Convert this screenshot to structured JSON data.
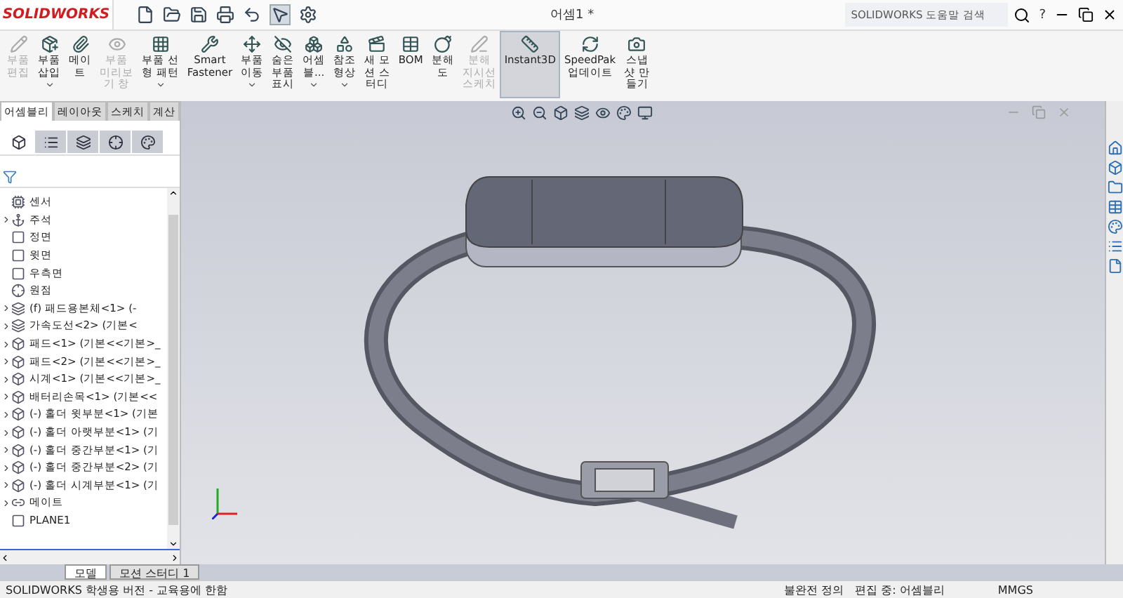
{
  "app": {
    "logo": "SOLIDWORKS",
    "title": "어셈1 *"
  },
  "search": {
    "placeholder": "SOLIDWORKS 도움말 검색"
  },
  "help": "?",
  "ribbon": [
    {
      "lines": [
        "부품",
        "편집"
      ],
      "disabled": true,
      "caret": false,
      "selected": false
    },
    {
      "lines": [
        "부품",
        "삽입"
      ],
      "disabled": false,
      "caret": true,
      "selected": false
    },
    {
      "lines": [
        "메이",
        "트"
      ],
      "disabled": false,
      "caret": false,
      "selected": false
    },
    {
      "lines": [
        "부품",
        "미리보",
        "기 창"
      ],
      "disabled": true,
      "caret": false,
      "selected": false
    },
    {
      "lines": [
        "부품 선",
        "형 패턴"
      ],
      "disabled": false,
      "caret": true,
      "selected": false
    },
    {
      "lines": [
        "Smart",
        "Fastener"
      ],
      "disabled": false,
      "caret": false,
      "selected": false
    },
    {
      "lines": [
        "부품",
        "이동"
      ],
      "disabled": false,
      "caret": true,
      "selected": false
    },
    {
      "lines": [
        "숨은",
        "부품",
        "표시"
      ],
      "disabled": false,
      "caret": false,
      "selected": false
    },
    {
      "lines": [
        "어셈",
        "블..."
      ],
      "disabled": false,
      "caret": true,
      "selected": false
    },
    {
      "lines": [
        "참조",
        "형상"
      ],
      "disabled": false,
      "caret": true,
      "selected": false
    },
    {
      "lines": [
        "새 모",
        "션 스",
        "터디"
      ],
      "disabled": false,
      "caret": false,
      "selected": false
    },
    {
      "lines": [
        "BOM"
      ],
      "disabled": false,
      "caret": false,
      "selected": false
    },
    {
      "lines": [
        "분해",
        "도"
      ],
      "disabled": false,
      "caret": false,
      "selected": false
    },
    {
      "lines": [
        "분해",
        "지시선",
        "스케치"
      ],
      "disabled": true,
      "caret": false,
      "selected": false
    },
    {
      "lines": [
        "Instant3D"
      ],
      "disabled": false,
      "caret": false,
      "selected": true
    },
    {
      "lines": [
        "SpeedPak",
        "업데이트"
      ],
      "disabled": false,
      "caret": false,
      "selected": false
    },
    {
      "lines": [
        "스냅",
        "샷 만",
        "들기"
      ],
      "disabled": false,
      "caret": false,
      "selected": false
    }
  ],
  "tabs": [
    {
      "label": "어셈블리",
      "selected": true
    },
    {
      "label": "레이아웃",
      "selected": false
    },
    {
      "label": "스케치",
      "selected": false
    },
    {
      "label": "계산",
      "selected": false
    }
  ],
  "tree": [
    {
      "kind": "sensor",
      "label": "센서",
      "expandable": false
    },
    {
      "kind": "annotation",
      "label": "주석",
      "expandable": true
    },
    {
      "kind": "plane",
      "label": "정면",
      "expandable": false
    },
    {
      "kind": "plane",
      "label": "윗면",
      "expandable": false
    },
    {
      "kind": "plane",
      "label": "우측면",
      "expandable": false
    },
    {
      "kind": "origin",
      "label": "원점",
      "expandable": false
    },
    {
      "kind": "subassembly",
      "label": "(f) 패드용본체<1> (-",
      "expandable": true
    },
    {
      "kind": "subassembly",
      "label": "가속도선<2> (기본<",
      "expandable": true
    },
    {
      "kind": "part",
      "label": "패드<1> (기본<<기본>_",
      "expandable": true
    },
    {
      "kind": "part",
      "label": "패드<2> (기본<<기본>_",
      "expandable": true
    },
    {
      "kind": "part",
      "label": "시계<1> (기본<<기본>_",
      "expandable": true
    },
    {
      "kind": "part",
      "label": "배터리손목<1> (기본<<",
      "expandable": true
    },
    {
      "kind": "part",
      "label": "(-) 홀더 윗부분<1> (기본",
      "expandable": true
    },
    {
      "kind": "part",
      "label": "(-) 홀더 아랫부분<1> (기",
      "expandable": true
    },
    {
      "kind": "part",
      "label": "(-) 홀더 중간부분<1> (기",
      "expandable": true
    },
    {
      "kind": "part",
      "label": "(-) 홀더 중간부분<2> (기",
      "expandable": true
    },
    {
      "kind": "part",
      "label": "(-) 홀더 시계부분<1> (기",
      "expandable": true
    },
    {
      "kind": "mate",
      "label": "메이트",
      "expandable": true
    },
    {
      "kind": "plane",
      "label": "PLANE1",
      "expandable": false
    }
  ],
  "bottom_tabs": [
    {
      "label": "모델",
      "selected": true
    },
    {
      "label": "모션 스터디 1",
      "selected": false
    }
  ],
  "status_bar": {
    "product": "SOLIDWORKS 학생용 버전 - 교육용에 한함",
    "definition": "불완전 정의",
    "editing": "편집 중: 어셈블리",
    "units": "MMGS"
  }
}
